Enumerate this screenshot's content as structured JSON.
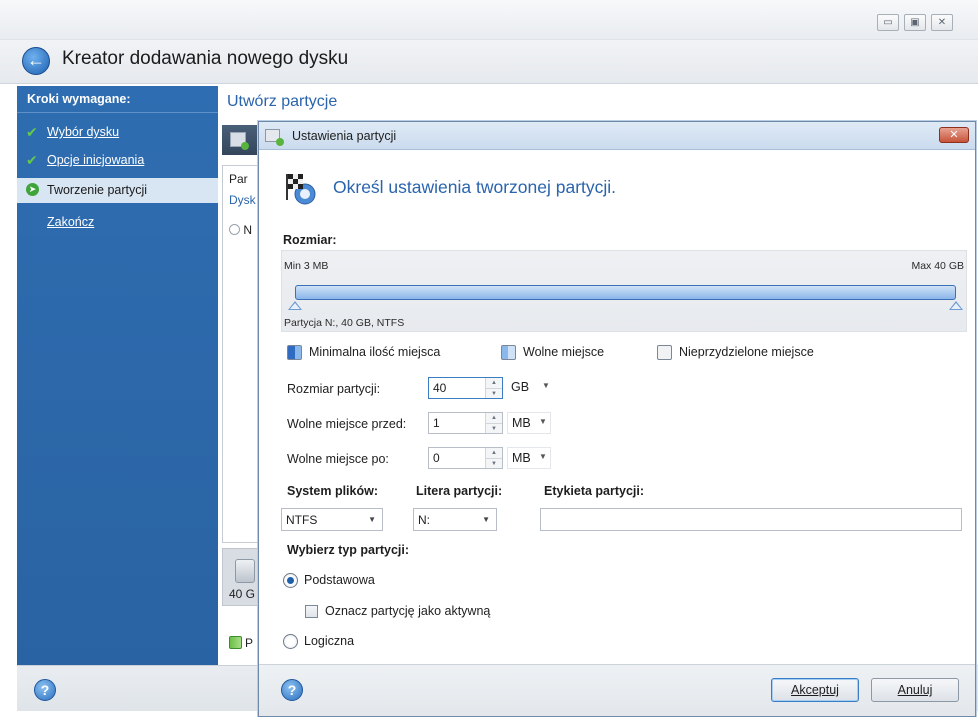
{
  "outer_window": {
    "title": "Kreator dodawania nowego dysku",
    "controls": {
      "minimize": "▭",
      "maximize": "▣",
      "close": "✕"
    }
  },
  "sidebar": {
    "heading": "Kroki wymagane:",
    "steps": [
      {
        "label": "Wybór dysku",
        "state": "done"
      },
      {
        "label": "Opcje inicjowania",
        "state": "done"
      },
      {
        "label": "Tworzenie partycji",
        "state": "current"
      },
      {
        "label": "Zakończ",
        "state": "pending"
      }
    ]
  },
  "main": {
    "heading": "Utwórz partycje",
    "table_header": "Par",
    "table_row_disk": "Dysk",
    "table_row_n": "N",
    "disk_size": "40 G",
    "legend_text": "P"
  },
  "dialog": {
    "title": "Ustawienia partycji",
    "close_label": "✕",
    "heading": "Określ ustawienia tworzonej partycji.",
    "size_section": "Rozmiar:",
    "slider": {
      "min_label": "Min 3 MB",
      "max_label": "Max 40 GB",
      "caption": "Partycja N:, 40 GB, NTFS",
      "fraction_start": 0.0,
      "fraction_end": 1.0
    },
    "legend": {
      "min_space": "Minimalna ilość miejsca",
      "free_space": "Wolne miejsce",
      "unallocated": "Nieprzydzielone miejsce"
    },
    "fields": {
      "partition_size": {
        "label": "Rozmiar partycji:",
        "value": "40",
        "unit": "GB"
      },
      "free_before": {
        "label": "Wolne miejsce przed:",
        "value": "1",
        "unit": "MB"
      },
      "free_after": {
        "label": "Wolne miejsce po:",
        "value": "0",
        "unit": "MB"
      }
    },
    "file_system": {
      "label": "System plików:",
      "value": "NTFS"
    },
    "drive_letter": {
      "label": "Litera partycji:",
      "value": "N:"
    },
    "volume_label": {
      "label": "Etykieta partycji:",
      "value": ""
    },
    "partition_type": {
      "label": "Wybierz typ partycji:",
      "primary": "Podstawowa",
      "mark_active": "Oznacz partycję jako aktywną",
      "logical": "Logiczna",
      "selected": "primary"
    },
    "buttons": {
      "ok": "Akceptuj",
      "cancel": "Anuluj"
    }
  },
  "colors": {
    "sidebar_bg": "#2e6db1",
    "heading_blue": "#2a64ad",
    "legend_min": "#2f6bc0",
    "legend_free": "#8ab8ea",
    "legend_unallocated": "#f0f2f4"
  },
  "icons": {
    "back": "back-arrow-icon",
    "help": "help-icon",
    "flag": "checkered-flag-icon"
  }
}
